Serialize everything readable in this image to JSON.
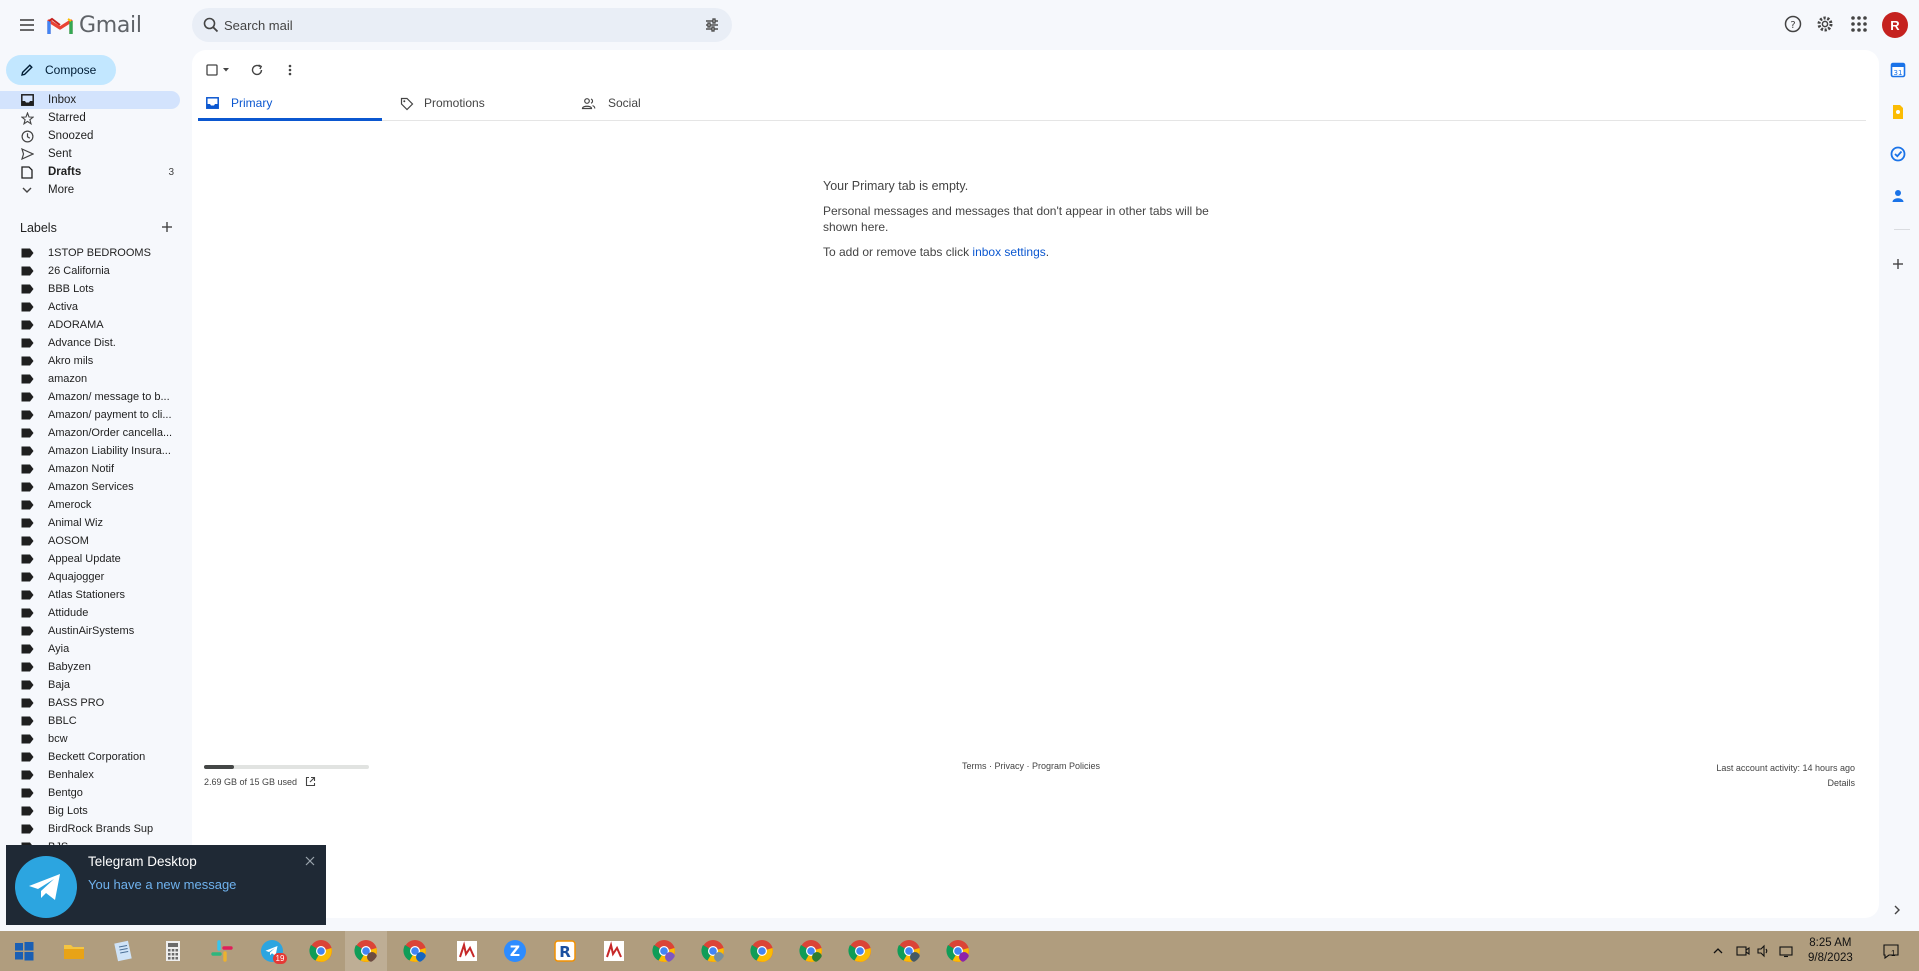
{
  "app": {
    "name": "Gmail",
    "avatar_letter": "R",
    "accent": "#0b57d0",
    "avatar_color": "#c5221f"
  },
  "search": {
    "placeholder": "Search mail"
  },
  "compose": {
    "label": "Compose"
  },
  "nav": {
    "items": [
      {
        "label": "Inbox",
        "icon": "inbox-icon",
        "active": true
      },
      {
        "label": "Starred",
        "icon": "star-icon"
      },
      {
        "label": "Snoozed",
        "icon": "clock-icon"
      },
      {
        "label": "Sent",
        "icon": "send-icon"
      },
      {
        "label": "Drafts",
        "icon": "draft-icon",
        "count": "3",
        "bold": true
      },
      {
        "label": "More",
        "icon": "chevron-down-icon"
      }
    ]
  },
  "labels": {
    "heading": "Labels",
    "items": [
      "1STOP BEDROOMS",
      "26 California",
      "BBB Lots",
      "Activa",
      "ADORAMA",
      "Advance Dist.",
      "Akro mils",
      "amazon",
      "Amazon/ message to b...",
      "Amazon/ payment to cli...",
      "Amazon/Order cancella...",
      "Amazon Liability Insura...",
      "Amazon Notif",
      "Amazon Services",
      "Amerock",
      "Animal Wiz",
      "AOSOM",
      "Appeal Update",
      "Aquajogger",
      "Atlas Stationers",
      "Attidude",
      "AustinAirSystems",
      "Ayia",
      "Babyzen",
      "Baja",
      "BASS PRO",
      "BBLC",
      "bcw",
      "Beckett Corporation",
      "Benhalex",
      "Bentgo",
      "Big Lots",
      "BirdRock Brands Sup",
      "BJS"
    ]
  },
  "tabs": [
    {
      "label": "Primary",
      "icon": "inbox-icon",
      "active": true
    },
    {
      "label": "Promotions",
      "icon": "tag-icon"
    },
    {
      "label": "Social",
      "icon": "people-icon"
    }
  ],
  "empty_state": {
    "title": "Your Primary tab is empty.",
    "line1": "Personal messages and messages that don't appear in other tabs will be shown here.",
    "line2_prefix": "To add or remove tabs click ",
    "line2_link": "inbox settings",
    "line2_suffix": "."
  },
  "footer": {
    "storage_text": "2.69 GB of 15 GB used",
    "storage_fraction": 0.18,
    "links": [
      "Terms",
      "Privacy",
      "Program Policies"
    ],
    "activity": "Last account activity: 14 hours ago",
    "details": "Details"
  },
  "toast": {
    "title": "Telegram Desktop",
    "message": "You have a new message"
  },
  "taskbar": {
    "telegram_badge": "19",
    "time": "8:25 AM",
    "date": "9/8/2023",
    "notification_count": "1"
  }
}
